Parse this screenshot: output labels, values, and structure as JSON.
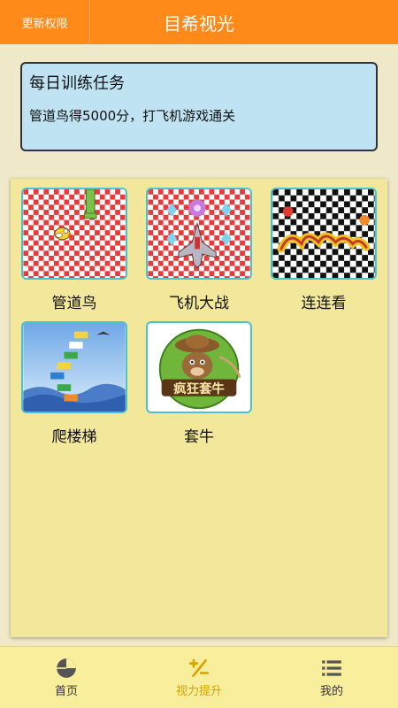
{
  "header": {
    "update_label": "更新权限",
    "title": "目希视光"
  },
  "task": {
    "title": "每日训练任务",
    "description": "管道鸟得5000分，打飞机游戏通关"
  },
  "games": [
    {
      "label": "管道鸟",
      "icon": "flappy-bird-icon"
    },
    {
      "label": "飞机大战",
      "icon": "plane-war-icon"
    },
    {
      "label": "连连看",
      "icon": "link-match-icon"
    },
    {
      "label": "爬楼梯",
      "icon": "climb-stairs-icon"
    },
    {
      "label": "套牛",
      "icon": "lasso-cow-icon"
    }
  ],
  "thumb_text": {
    "cow_game_text": "疯狂套牛"
  },
  "tabs": [
    {
      "label": "首页",
      "icon": "pie-chart-icon",
      "active": false
    },
    {
      "label": "视力提升",
      "icon": "plus-minus-icon",
      "active": true
    },
    {
      "label": "我的",
      "icon": "list-icon",
      "active": false
    }
  ],
  "colors": {
    "header": "#ff8a1a",
    "task_card": "#bfe3f3",
    "panel": "#f2e79a",
    "thumb_border": "#49c2cf",
    "active_tab": "#d8a400"
  }
}
